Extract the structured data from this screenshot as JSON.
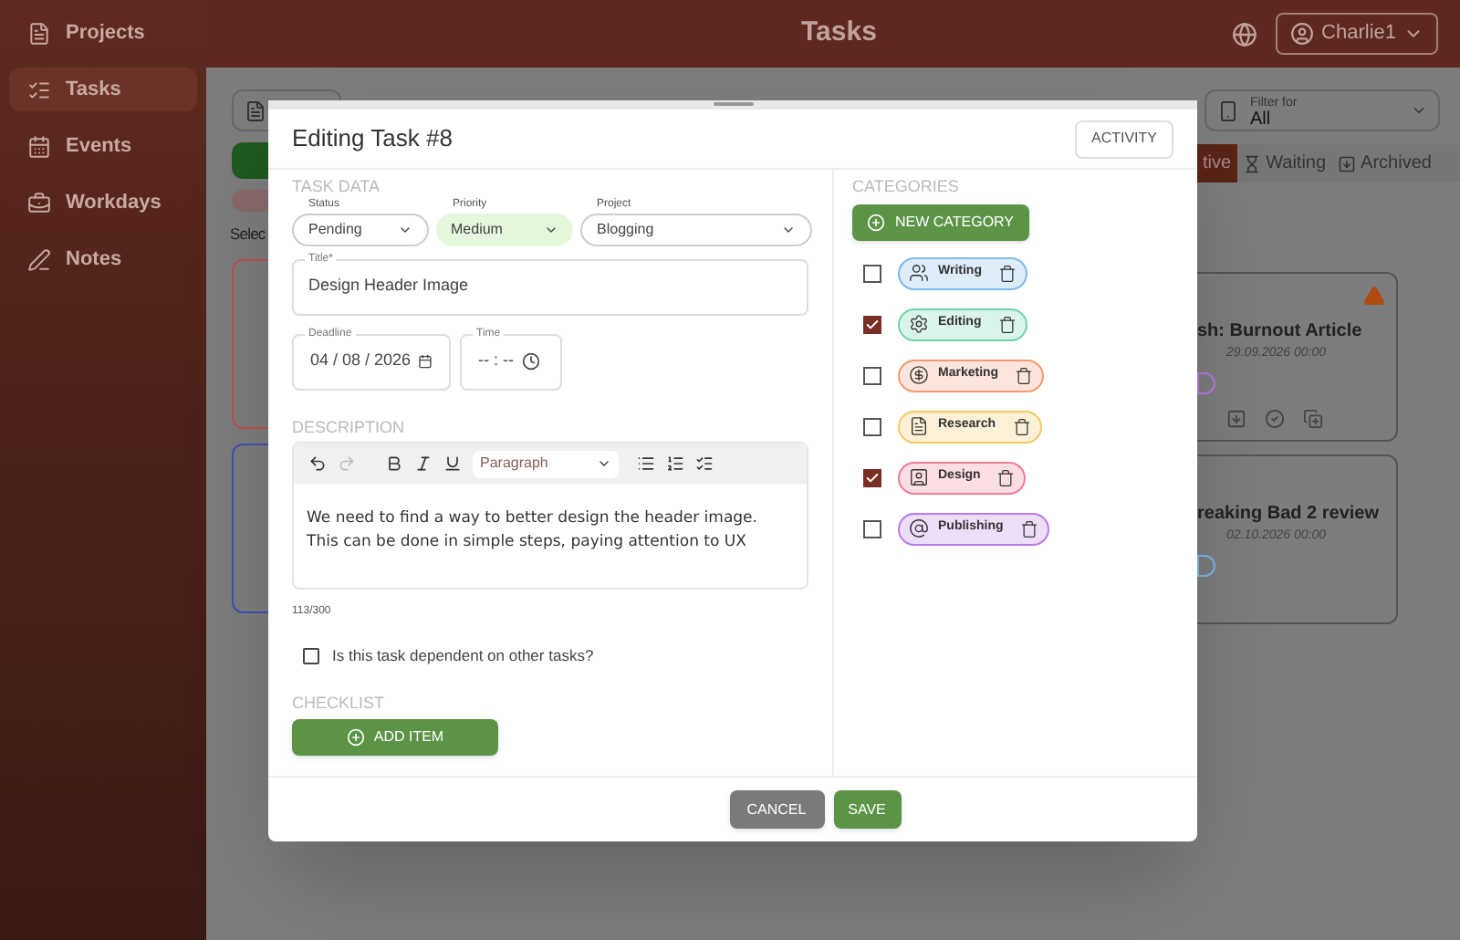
{
  "sidebar": {
    "items": [
      {
        "label": "Projects",
        "selected": false
      },
      {
        "label": "Tasks",
        "selected": true
      },
      {
        "label": "Events",
        "selected": false
      },
      {
        "label": "Workdays",
        "selected": false
      },
      {
        "label": "Notes",
        "selected": false
      }
    ]
  },
  "header": {
    "title": "Tasks",
    "user": "Charlie1"
  },
  "background": {
    "select_label": "Selec",
    "filter": {
      "label": "Filter for",
      "value": "All"
    },
    "status_tabs": [
      {
        "label": "tive",
        "selected": true
      },
      {
        "label": "Waiting",
        "selected": false
      },
      {
        "label": "Archived",
        "selected": false
      }
    ],
    "left_cards": [
      {
        "color": "#c0504d"
      },
      {
        "color": "#3f51b5"
      }
    ],
    "right_cards": [
      {
        "title": "sh: Burnout Article",
        "date": "29.09.2026 00:00",
        "warning": true
      },
      {
        "title": "reaking Bad 2 review",
        "date": "02.10.2026 00:00",
        "warning": false
      }
    ]
  },
  "modal": {
    "title": "Editing Task #8",
    "activity_button": "ACTIVITY",
    "task_data": {
      "heading": "TASK DATA",
      "selects": [
        {
          "label": "Status",
          "value": "Pending",
          "highlighted": false
        },
        {
          "label": "Priority",
          "value": "Medium",
          "highlighted": true
        },
        {
          "label": "Project",
          "value": "Blogging",
          "highlighted": false
        }
      ]
    },
    "title_field": {
      "label": "Title*",
      "value": "Design Header Image"
    },
    "deadline": {
      "label": "Deadline",
      "value": "04 / 08 / 2026"
    },
    "time": {
      "label": "Time",
      "value": "-- : --"
    },
    "description": {
      "heading": "DESCRIPTION",
      "format": "Paragraph",
      "text": "We need to find a way to better design the header image. This can be done in simple steps, paying attention to UX",
      "counter": "113/300"
    },
    "dependent": {
      "label": "Is this task dependent on other tasks?",
      "checked": false
    },
    "checklist": {
      "heading": "CHECKLIST",
      "add_button": "ADD ITEM"
    },
    "categories": {
      "heading": "CATEGORIES",
      "new_button": "NEW CATEGORY",
      "items": [
        {
          "name": "Writing",
          "checked": false,
          "color": "#7ab8ea"
        },
        {
          "name": "Editing",
          "checked": true,
          "color": "#6fd3a8"
        },
        {
          "name": "Marketing",
          "checked": false,
          "color": "#f39a70"
        },
        {
          "name": "Research",
          "checked": false,
          "color": "#f2c860"
        },
        {
          "name": "Design",
          "checked": true,
          "color": "#ee7c93"
        },
        {
          "name": "Publishing",
          "checked": false,
          "color": "#b97ae8"
        }
      ]
    },
    "footer": {
      "cancel": "CANCEL",
      "save": "SAVE"
    }
  }
}
